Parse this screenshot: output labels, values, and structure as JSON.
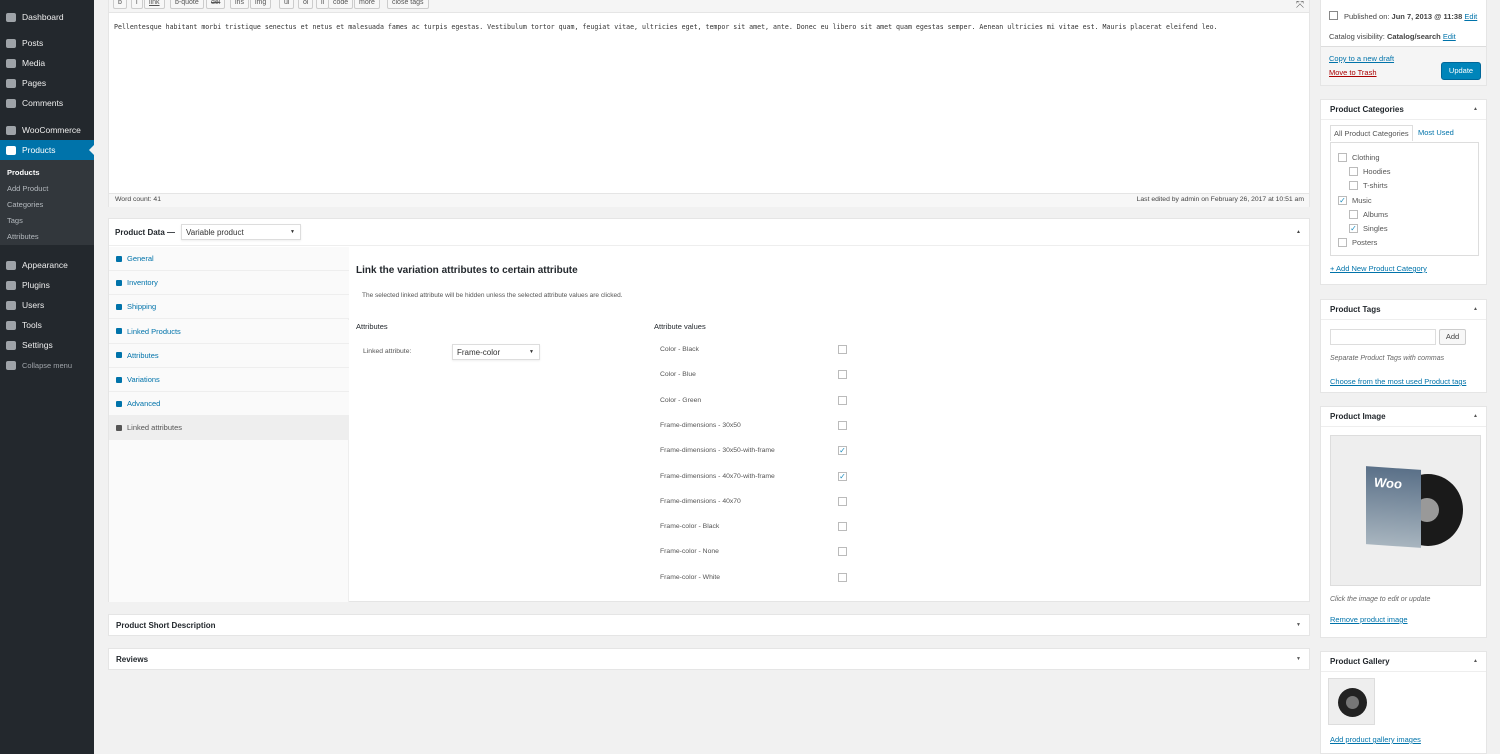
{
  "sidebar": {
    "items": [
      {
        "label": "Dashboard",
        "icon": "dashboard-icon"
      },
      {
        "label": "Posts",
        "icon": "pin-icon"
      },
      {
        "label": "Media",
        "icon": "media-icon"
      },
      {
        "label": "Pages",
        "icon": "pages-icon"
      },
      {
        "label": "Comments",
        "icon": "comment-icon"
      },
      {
        "label": "WooCommerce",
        "icon": "woo-icon"
      },
      {
        "label": "Products",
        "icon": "cube-icon"
      },
      {
        "label": "Appearance",
        "icon": "brush-icon"
      },
      {
        "label": "Plugins",
        "icon": "plugin-icon"
      },
      {
        "label": "Users",
        "icon": "user-icon"
      },
      {
        "label": "Tools",
        "icon": "wrench-icon"
      },
      {
        "label": "Settings",
        "icon": "settings-icon"
      },
      {
        "label": "Collapse menu",
        "icon": "collapse-icon"
      }
    ],
    "submenu": [
      "Products",
      "Add Product",
      "Categories",
      "Tags",
      "Attributes"
    ],
    "accent": "#0073aa"
  },
  "editor": {
    "toolbar": [
      "b",
      "i",
      "link",
      "b-quote",
      "del",
      "ins",
      "img",
      "ul",
      "ol",
      "li",
      "code",
      "more",
      "close tags"
    ],
    "content": "Pellentesque habitant morbi tristique senectus et netus et malesuada fames ac turpis egestas. Vestibulum tortor quam, feugiat vitae, ultricies eget, tempor sit amet, ante. Donec eu libero sit amet quam egestas semper. Aenean ultricies mi vitae est. Mauris placerat eleifend leo.",
    "word_count": "Word count: 41",
    "last_edited": "Last edited by admin on February 26, 2017 at 10:51 am"
  },
  "product_data": {
    "title": "Product Data —",
    "type": "Variable product",
    "tabs": [
      "General",
      "Inventory",
      "Shipping",
      "Linked Products",
      "Attributes",
      "Variations",
      "Advanced",
      "Linked attributes"
    ],
    "heading": "Link the variation attributes to certain attribute",
    "description": "The selected linked attribute will be hidden unless the selected attribute values are clicked.",
    "attributes_label": "Attributes",
    "linked_label": "Linked attribute:",
    "linked_value": "Frame-color",
    "values_label": "Attribute values",
    "values": [
      {
        "label": "Color - Black",
        "checked": false
      },
      {
        "label": "Color - Blue",
        "checked": false
      },
      {
        "label": "Color - Green",
        "checked": false
      },
      {
        "label": "Frame-dimensions - 30x50",
        "checked": false
      },
      {
        "label": "Frame-dimensions - 30x50-with-frame",
        "checked": true
      },
      {
        "label": "Frame-dimensions - 40x70-with-frame",
        "checked": true
      },
      {
        "label": "Frame-dimensions - 40x70",
        "checked": false
      },
      {
        "label": "Frame-color - Black",
        "checked": false
      },
      {
        "label": "Frame-color - None",
        "checked": false
      },
      {
        "label": "Frame-color - White",
        "checked": false
      }
    ]
  },
  "short_description": "Product Short Description",
  "reviews": "Reviews",
  "publish": {
    "published_label": "Published on:",
    "published_value": "Jun 7, 2013 @ 11:38",
    "edit": "Edit",
    "visibility_label": "Catalog visibility:",
    "visibility_value": "Catalog/search",
    "copy": "Copy to a new draft",
    "trash": "Move to Trash",
    "update": "Update"
  },
  "categories": {
    "title": "Product Categories",
    "tab_all": "All Product Categories",
    "tab_most": "Most Used",
    "items": [
      {
        "label": "Clothing",
        "checked": false,
        "child": false
      },
      {
        "label": "Hoodies",
        "checked": false,
        "child": true
      },
      {
        "label": "T-shirts",
        "checked": false,
        "child": true
      },
      {
        "label": "Music",
        "checked": true,
        "child": false
      },
      {
        "label": "Albums",
        "checked": false,
        "child": true
      },
      {
        "label": "Singles",
        "checked": true,
        "child": true
      },
      {
        "label": "Posters",
        "checked": false,
        "child": false
      }
    ],
    "add": "+ Add New Product Category"
  },
  "tags": {
    "title": "Product Tags",
    "add": "Add",
    "hint": "Separate Product Tags with commas",
    "choose": "Choose from the most used Product tags"
  },
  "image": {
    "title": "Product Image",
    "logo_text": "Woo",
    "hint": "Click the image to edit or update",
    "remove": "Remove product image"
  },
  "gallery": {
    "title": "Product Gallery",
    "add": "Add product gallery images"
  }
}
